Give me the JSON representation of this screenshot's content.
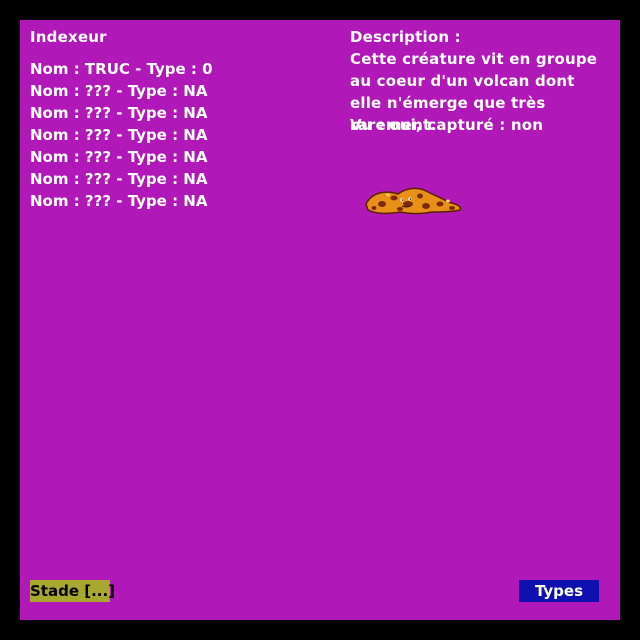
{
  "colors": {
    "background": "#000000",
    "panel": "#b018b8",
    "text": "#ffffff",
    "stade_button": "#a8a830",
    "types_button": "#1010b0"
  },
  "index": {
    "title": "Indexeur",
    "entries": [
      "Nom : TRUC - Type : 0",
      "Nom : ??? - Type : NA",
      "Nom : ??? - Type : NA",
      "Nom : ??? - Type : NA",
      "Nom : ??? - Type : NA",
      "Nom : ??? - Type : NA",
      "Nom : ??? - Type : NA"
    ]
  },
  "description": {
    "title": "Description :",
    "text": "Cette créature vit en groupe au coeur d'un volcan dont elle n'émerge que très rarement.",
    "status": "Vu : oui, capturé : non"
  },
  "creature": {
    "icon": "lava-creature-sprite"
  },
  "buttons": {
    "stade": "Stade [...]",
    "types": "Types"
  }
}
